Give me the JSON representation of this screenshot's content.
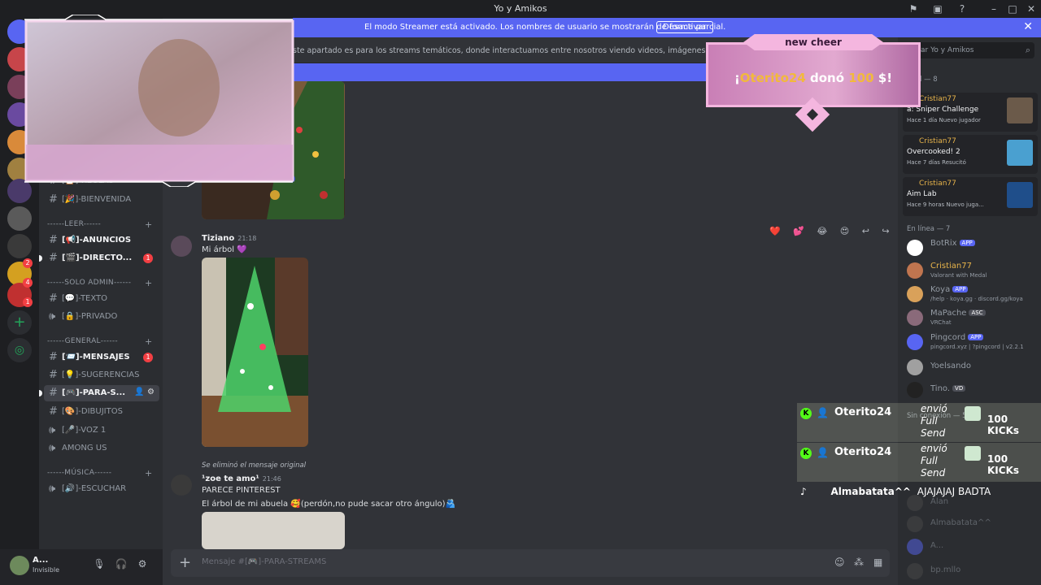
{
  "window": {
    "title": "Yo y Amikos"
  },
  "streamer_banner": {
    "text": "El modo Streamer está activado. Los nombres de usuario se mostrarán de forma parcial.",
    "button": "Desactivar"
  },
  "guild_badges": [
    "2",
    "4",
    "1"
  ],
  "channels": {
    "items": [
      {
        "label": "[📋]-REGLAS"
      },
      {
        "label": "[🎉]-BIENVENIDA"
      }
    ],
    "categories": {
      "leer": "------LEER------",
      "solo_admin": "------SOLO ADMIN------",
      "general": "------GENERAL------",
      "musica": "------MÚSICA------"
    },
    "leer_items": [
      {
        "label": "[📢]-ANUNCIOS"
      },
      {
        "label": "[🎬]-DIRECTO...",
        "badge": "1"
      }
    ],
    "admin_items": [
      {
        "label": "[💬]-TEXTO"
      },
      {
        "label": "[🔒]-PRIVADO"
      }
    ],
    "general_items": [
      {
        "label": "[📨]-MENSAJES",
        "badge": "1"
      },
      {
        "label": "[💡]-SUGERENCIAS"
      },
      {
        "label": "[🎮]-PARA-S..."
      },
      {
        "label": "[🎨]-DIBUJITOS"
      },
      {
        "label": "[🎤]-VOZ 1"
      },
      {
        "label": "AMONG US"
      }
    ],
    "music_items": [
      {
        "label": "[🔊]-ESCUCHAR"
      }
    ]
  },
  "user_panel": {
    "name": "A...",
    "status": "Invisible"
  },
  "chat": {
    "topic": "ste apartado es para los streams temáticos, donde interactuamos entre nosotros viendo videos, imágenes o links que us",
    "msg1": {
      "author": "Tiziano",
      "time": "21:18",
      "text": "Mi árbol 💜"
    },
    "msg2": {
      "reply_note": "Se eliminó el mensaje original",
      "author": "¹zoe te amo¹",
      "time": "21:46",
      "line1": "PARECE PINTEREST",
      "line2": "El árbol de mi abuela 🥰(perdón,no pude sacar otro ángulo)🫂"
    },
    "reactions": "❤️ 💕 😂 😍 ↩ ↪ ⋯",
    "composer_placeholder": "Mensaje #[🎮]-PARA-STREAMS"
  },
  "members": {
    "search_placeholder": "ar Yo y Amikos",
    "activity_header": "idad — 8",
    "activities": [
      {
        "name": "Cristian77",
        "game": "a: Sniper Challenge",
        "meta": "Hace 1 día   Nuevo jugador",
        "thumb": "#6b5a4a"
      },
      {
        "name": "Cristian77",
        "game": "Overcooked! 2",
        "meta": "Hace 7 días   Resucitó",
        "thumb": "#4aa0d0"
      },
      {
        "name": "Cristian77",
        "game": "Aim Lab",
        "meta": "Hace 9 horas   Nuevo juga...",
        "thumb": "#1f4e8a"
      }
    ],
    "online_header": "En línea — 7",
    "online": [
      {
        "name": "BotRix",
        "tag": "APP",
        "status": "",
        "color": "#949ba4",
        "av": "#ffffff"
      },
      {
        "name": "Cristian77",
        "tag": "",
        "status": "Valorant with Medal",
        "color": "#e8b44a",
        "av": "#c0754f"
      },
      {
        "name": "Koya",
        "tag": "APP",
        "status": "/help · koya.gg · discord.gg/koya",
        "color": "#949ba4",
        "av": "#d9a15a"
      },
      {
        "name": "MaPache",
        "tag": "ASC",
        "status": "VRChat",
        "color": "#949ba4",
        "av": "#8a6a7a"
      },
      {
        "name": "Pingcord",
        "tag": "APP",
        "status": "pingcord.xyz | ?pingcord | v2.2.1",
        "color": "#949ba4",
        "av": "#5865f2"
      },
      {
        "name": "Yoelsando",
        "tag": "",
        "status": "",
        "color": "#949ba4",
        "av": "#a0a0a0"
      },
      {
        "name": "Tino.",
        "tag": "VD",
        "status": "",
        "color": "#949ba4",
        "av": "#222222"
      }
    ],
    "offline_header": "Sin conexión — 55",
    "offline": [
      "Alan",
      "Almabatata^^",
      "A...",
      "bp.mllo"
    ]
  },
  "overlay": {
    "cheer": {
      "title": "new cheer",
      "prefix": "¡",
      "user": "Oterito24",
      "mid": " donó ",
      "amount": "100",
      "suffix": " $!"
    },
    "alerts": [
      {
        "user": "Oterito24",
        "action": "envió Full Send",
        "amount": "100 KICKs"
      },
      {
        "user": "Oterito24",
        "action": "envió Full Send",
        "amount": "100 KICKs"
      }
    ],
    "tiktok": {
      "user": "Almabatata^^",
      "text": "AJAJAJAJ BADTA"
    }
  }
}
